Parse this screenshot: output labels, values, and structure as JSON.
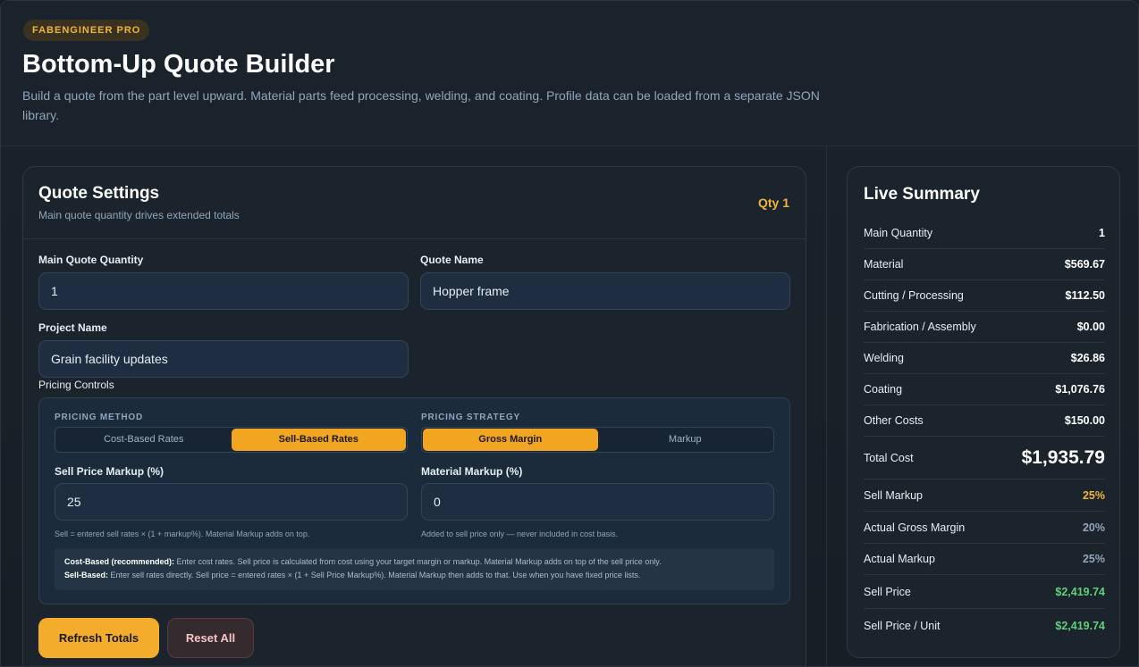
{
  "header": {
    "badge": "FABENGINEER PRO",
    "title": "Bottom-Up Quote Builder",
    "subtitle": "Build a quote from the part level upward. Material parts feed processing, welding, and coating. Profile data can be loaded from a separate JSON library."
  },
  "settings": {
    "title": "Quote Settings",
    "subtitle": "Main quote quantity drives extended totals",
    "qty_pill": "Qty 1",
    "main_qty_label": "Main Quote Quantity",
    "main_qty_value": "1",
    "quote_name_label": "Quote Name",
    "quote_name_value": "Hopper frame",
    "project_name_label": "Project Name",
    "project_name_value": "Grain facility updates",
    "pricing_controls_label": "Pricing Controls"
  },
  "pricing": {
    "method_caption": "PRICING METHOD",
    "method_options": [
      "Cost-Based Rates",
      "Sell-Based Rates"
    ],
    "method_selected": "Sell-Based Rates",
    "strategy_caption": "PRICING STRATEGY",
    "strategy_options": [
      "Gross Margin",
      "Markup"
    ],
    "strategy_selected": "Gross Margin",
    "sell_markup_label": "Sell Price Markup (%)",
    "sell_markup_value": "25",
    "sell_markup_help": "Sell = entered sell rates × (1 + markup%). Material Markup adds on top.",
    "material_markup_label": "Material Markup (%)",
    "material_markup_value": "0",
    "material_markup_help": "Added to sell price only — never included in cost basis.",
    "note_cost_title": "Cost-Based (recommended):",
    "note_cost_text": " Enter cost rates. Sell price is calculated from cost using your target margin or markup. Material Markup adds on top of the sell price only.",
    "note_sell_title": "Sell-Based:",
    "note_sell_text": " Enter sell rates directly. Sell price = entered rates × (1 + Sell Price Markup%). Material Markup then adds to that. Use when you have fixed price lists."
  },
  "actions": {
    "refresh": "Refresh Totals",
    "reset": "Reset All"
  },
  "summary": {
    "title": "Live Summary",
    "rows": [
      {
        "label": "Main Quantity",
        "value": "1"
      },
      {
        "label": "Material",
        "value": "$569.67"
      },
      {
        "label": "Cutting / Processing",
        "value": "$112.50"
      },
      {
        "label": "Fabrication / Assembly",
        "value": "$0.00"
      },
      {
        "label": "Welding",
        "value": "$26.86"
      },
      {
        "label": "Coating",
        "value": "$1,076.76"
      },
      {
        "label": "Other Costs",
        "value": "$150.00"
      },
      {
        "label": "Total Cost",
        "value": "$1,935.79"
      },
      {
        "label": "Sell Markup",
        "value": "25%"
      },
      {
        "label": "Actual Gross Margin",
        "value": "20%"
      },
      {
        "label": "Actual Markup",
        "value": "25%"
      },
      {
        "label": "Sell Price",
        "value": "$2,419.74"
      },
      {
        "label": "Sell Price / Unit",
        "value": "$2,419.74"
      }
    ]
  },
  "colors": {
    "accent": "#f2a521",
    "positive": "#5fd07a",
    "muted": "#8fa6bd"
  }
}
